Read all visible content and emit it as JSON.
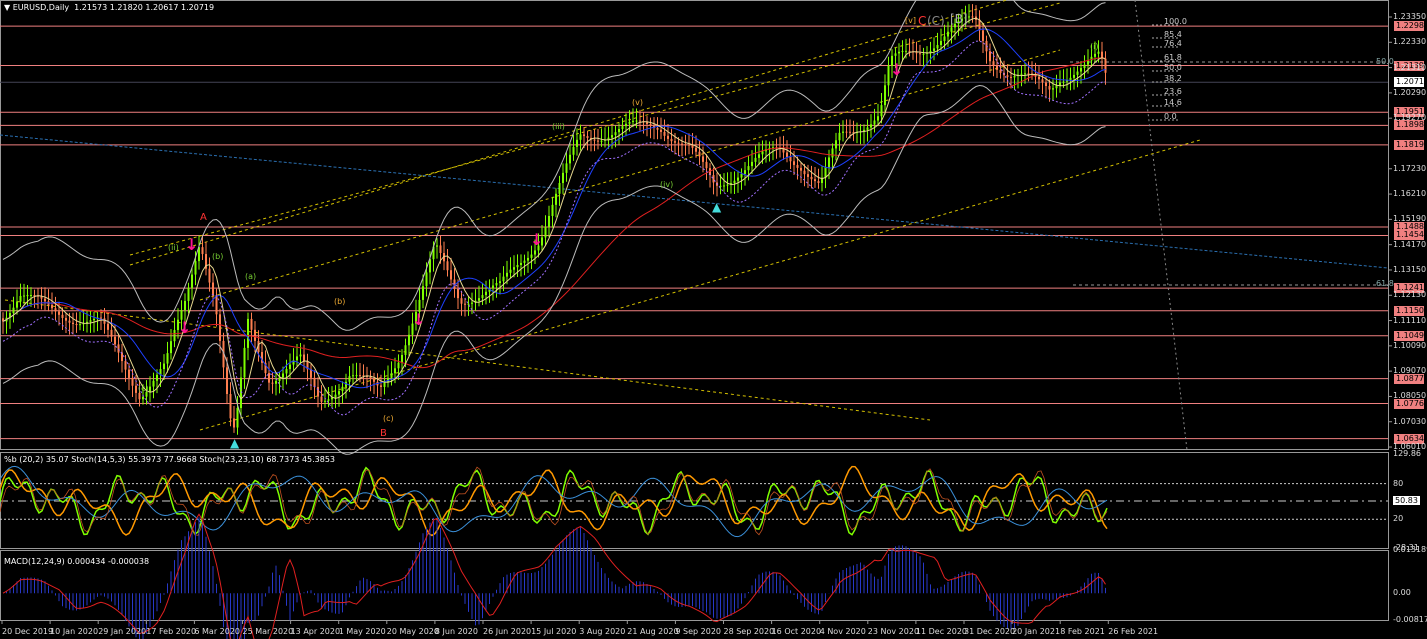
{
  "header": {
    "symbol": "EURUSD,Daily",
    "ohlc": "1.21573 1.21820 1.20617 1.20719",
    "menu_icon": "triangle-down-icon"
  },
  "price_axis": {
    "ticks": [
      "1.23350",
      "1.22330",
      "1.21310",
      "1.20290",
      "1.19270",
      "1.17230",
      "1.16210",
      "1.15190",
      "1.14170",
      "1.13150",
      "1.12130",
      "1.11110",
      "1.10090",
      "1.09070",
      "1.08050",
      "1.07030",
      "1.06010"
    ],
    "levels": [
      "1.22980",
      "1.21393",
      "1.19510",
      "1.18982",
      "1.18196",
      "1.14883",
      "1.14541",
      "1.12416",
      "1.11506",
      "1.10499",
      "1.08770",
      "1.07765",
      "1.06348"
    ],
    "current": "1.20719"
  },
  "fib": {
    "levels": [
      "100.0",
      "85.4",
      "76.4",
      "61.8",
      "50.0",
      "38.2",
      "23.6",
      "14.6",
      "0.0"
    ],
    "side_50": "50.0",
    "side_61": "61.8"
  },
  "wave_labels": {
    "big_a": "A",
    "big_b": "B",
    "big_c": "C",
    "c_paren": "(C)",
    "b_box": "[B]",
    "m_box": "[v]",
    "ii": "(ii)",
    "i": "(i)",
    "iii": "(iii)",
    "iv": "(iv)",
    "v": "(v)",
    "b": "(b)",
    "c": "(c)",
    "a": "(a)"
  },
  "oscillator": {
    "label": "%b (20,2) 35.07  Stoch(14,5,3) 55.3973 77.9668  Stoch(23,23,10) 68.7373 45.3853",
    "ticks": [
      "129.86",
      "80",
      "50.83",
      "20",
      "-28.31"
    ],
    "current": "50.83"
  },
  "macd": {
    "label": "MACD(12,24,9) 0.000434 -0.000038",
    "ticks": [
      "0.013189",
      "0.00",
      "-0.008179"
    ]
  },
  "time_axis": {
    "dates": [
      "20 Dec 2019",
      "10 Jan 2020",
      "29 Jan 2020",
      "17 Feb 2020",
      "6 Mar 2020",
      "25 Mar 2020",
      "13 Apr 2020",
      "1 May 2020",
      "20 May 2020",
      "8 Jun 2020",
      "26 Jun 2020",
      "15 Jul 2020",
      "3 Aug 2020",
      "21 Aug 2020",
      "9 Sep 2020",
      "28 Sep 2020",
      "16 Oct 2020",
      "4 Nov 2020",
      "23 Nov 2020",
      "11 Dec 2020",
      "31 Dec 2020",
      "20 Jan 2021",
      "8 Feb 2021",
      "26 Feb 2021"
    ]
  },
  "colors": {
    "level": "#f08080",
    "bull": "#7fff00",
    "bear": "#ff7f50",
    "ma_red": "#e02020",
    "ma_blue": "#1e40ff",
    "channel": "#d4c000"
  }
}
